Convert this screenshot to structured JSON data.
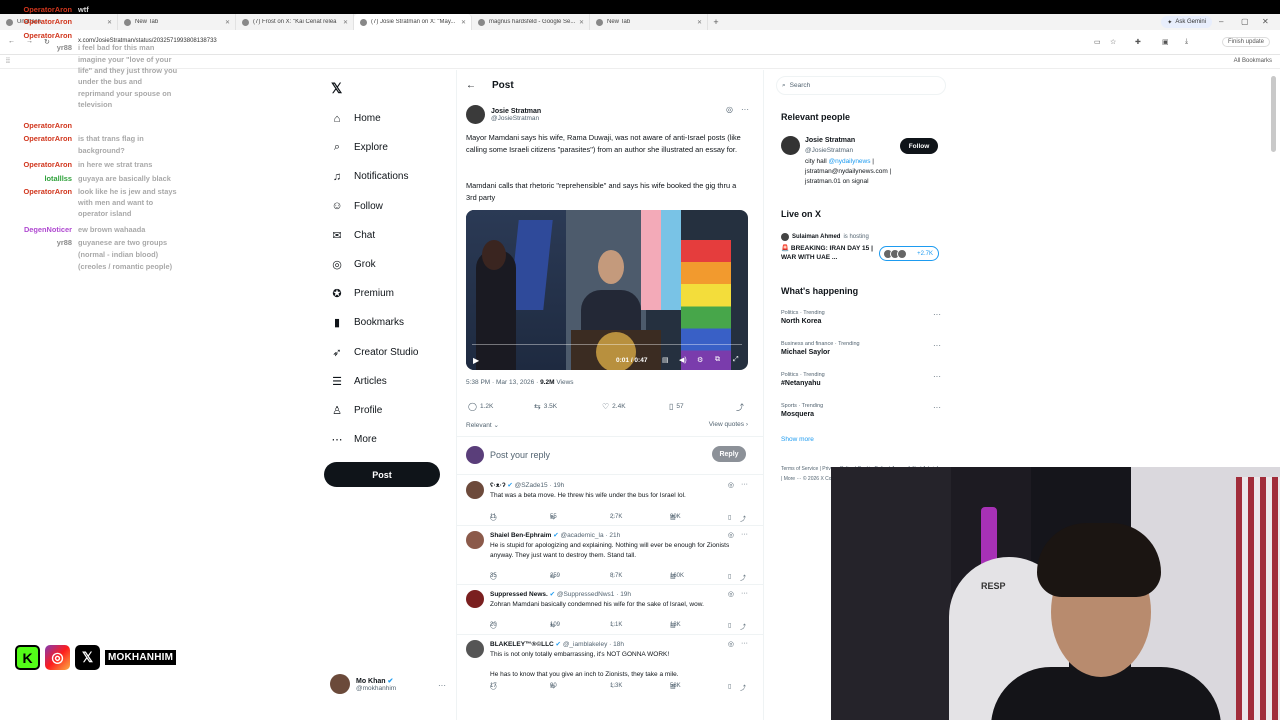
{
  "browser": {
    "tabs": [
      {
        "title": "Unattach",
        "active": false
      },
      {
        "title": "New Tab",
        "active": false
      },
      {
        "title": "(7) Frost on X: \"Kai Cenat relea",
        "active": false
      },
      {
        "title": "(7) Josie Stratman on X: \"May...",
        "active": true
      },
      {
        "title": "magnus hardsfeld - Google Se...",
        "active": false
      },
      {
        "title": "New Tab",
        "active": false
      }
    ],
    "ask_gemini": "Ask Gemini",
    "url": "x.com/JosieStratman/status/2032571993808138733",
    "finish_update": "Finish update",
    "all_bookmarks": "All Bookmarks"
  },
  "chat": [
    {
      "user": "OperatorAron",
      "color": "#d1361d",
      "msg": "wtf",
      "msg_white": true
    },
    {
      "user": "OperatorAron",
      "color": "#d1361d",
      "msg": ""
    },
    {
      "user": "OperatorAron",
      "color": "#d1361d",
      "msg": ""
    },
    {
      "user": "yr88",
      "color": "#8a8a8a",
      "msg": "i feel bad for this man"
    },
    {
      "user": "",
      "color": "#8a8a8a",
      "msg": "imagine your \"love of your"
    },
    {
      "user": "",
      "color": "#8a8a8a",
      "msg": "life\" and they just throw you"
    },
    {
      "user": "",
      "color": "#8a8a8a",
      "msg": "under the bus and"
    },
    {
      "user": "",
      "color": "#8a8a8a",
      "msg": "reprimand your spouse on"
    },
    {
      "user": "",
      "color": "#8a8a8a",
      "msg": "television"
    },
    {
      "user": "OperatorAron",
      "color": "#d1361d",
      "msg": ""
    },
    {
      "user": "OperatorAron",
      "color": "#d1361d",
      "msg": "is that trans flag in"
    },
    {
      "user": "",
      "color": "#8a8a8a",
      "msg": "background?"
    },
    {
      "user": "OperatorAron",
      "color": "#d1361d",
      "msg": "in here we strat trans"
    },
    {
      "user": "lotalllss",
      "color": "#2fa23b",
      "msg": "guyaya are basically black"
    },
    {
      "user": "OperatorAron",
      "color": "#d1361d",
      "msg": "look like he is jew and stays"
    },
    {
      "user": "",
      "color": "#8a8a8a",
      "msg": "with men and want to"
    },
    {
      "user": "",
      "color": "#8a8a8a",
      "msg": "operator island"
    },
    {
      "user": "DegenNoticer",
      "color": "#b04ad1",
      "msg": "ew brown wahaada"
    },
    {
      "user": "yr88",
      "color": "#8a8a8a",
      "msg": "guyanese are two groups"
    },
    {
      "user": "",
      "color": "#8a8a8a",
      "msg": "(normal - indian blood)"
    },
    {
      "user": "",
      "color": "#8a8a8a",
      "msg": "(creoles / romantic people)"
    }
  ],
  "nav": {
    "items": [
      {
        "label": "Home",
        "icon": "home-icon",
        "glyph": "⌂"
      },
      {
        "label": "Explore",
        "icon": "search-icon",
        "glyph": "⌕"
      },
      {
        "label": "Notifications",
        "icon": "bell-icon",
        "glyph": "♫"
      },
      {
        "label": "Follow",
        "icon": "person-plus-icon",
        "glyph": "☺"
      },
      {
        "label": "Chat",
        "icon": "message-icon",
        "glyph": "✉"
      },
      {
        "label": "Grok",
        "icon": "grok-icon",
        "glyph": "◎"
      },
      {
        "label": "Premium",
        "icon": "verified-badge-icon",
        "glyph": "✪"
      },
      {
        "label": "Bookmarks",
        "icon": "bookmark-icon",
        "glyph": "▮"
      },
      {
        "label": "Creator Studio",
        "icon": "rocket-icon",
        "glyph": "➶"
      },
      {
        "label": "Articles",
        "icon": "document-icon",
        "glyph": "☰"
      },
      {
        "label": "Profile",
        "icon": "user-icon",
        "glyph": "♙"
      },
      {
        "label": "More",
        "icon": "more-circle-icon",
        "glyph": "⋯"
      }
    ],
    "post_label": "Post",
    "account": {
      "name": "Mo Khan",
      "handle": "@mokhanhim"
    }
  },
  "post": {
    "header": "Post",
    "author_name": "Josie Stratman",
    "author_handle": "@JosieStratman",
    "text1": "Mayor Mamdani says his wife, Rama Duwaji, was not aware of anti-Israel posts (like calling some Israeli citizens \"parasites\") from an author she illustrated an essay for.",
    "text2": "Mamdani calls that rhetoric \"reprehensible\" and says his wife booked the gig thru a 3rd party",
    "video_time": "0:01 / 0:47",
    "time": "5:38 PM · Mar 13, 2026 · ",
    "views_count": "9.2M",
    "views_label": " Views",
    "replies": "1.2K",
    "reposts": "3.5K",
    "likes": "2.4K",
    "bookmarks": "57",
    "sort": "Relevant ⌄",
    "view_quotes": "View quotes ›",
    "reply_placeholder": "Post your reply",
    "reply_button": "Reply"
  },
  "replies": [
    {
      "name": "ʕ·ᴥ·ʔ",
      "handle": "@SZade15 · 19h",
      "text": "That was a beta move. He threw his wife under the bus for Israel lol.",
      "stats": [
        "11",
        "55",
        "2.7K",
        "90K"
      ]
    },
    {
      "name": "Shaiel Ben-Ephraim",
      "handle": "@academic_la · 21h",
      "text": "He is stupid for apologizing and explaining. Nothing will ever be enough for Zionists anyway. They just want to destroy them. Stand tall.",
      "stats": [
        "35",
        "259",
        "8.7K",
        "160K"
      ]
    },
    {
      "name": "Suppressed News.",
      "handle": "@SuppressedNws1 · 19h",
      "text": "Zohran Mamdani basically condemned his wife for the sake of Israel, wow.",
      "stats": [
        "20",
        "109",
        "1.1K",
        "13K"
      ]
    },
    {
      "name": "BLAKELEY™®©LLC",
      "handle": "@_iamblakeley · 18h",
      "text": "This is not only totally embarrassing, it's NOT GONNA WORK!\n\nHe has to know that you give an inch to Zionists, they take a mile.",
      "stats": [
        "17",
        "90",
        "1.3K",
        "58K"
      ]
    }
  ],
  "right": {
    "search_placeholder": "Search",
    "relevant_people": "Relevant people",
    "rp_name": "Josie Stratman",
    "rp_handle": "@JosieStratman",
    "rp_bio_1": "city hall ",
    "rp_bio_link": "@nydailynews",
    "rp_bio_2": " | jstratman@nydailynews.com | jstratman.01 on signal",
    "follow": "Follow",
    "live_title": "Live on X",
    "live_host": "Sulaiman Ahmed",
    "live_host_suffix": " is hosting",
    "live_stream": "🚨 BREAKING: IRAN DAY 15 | WAR WITH UAE ...",
    "live_count": "+2.7K",
    "happening": "What's happening",
    "trends": [
      {
        "context": "Politics · Trending",
        "name": "North Korea"
      },
      {
        "context": "Business and finance · Trending",
        "name": "Michael Saylor"
      },
      {
        "context": "Politics · Trending",
        "name": "#Netanyahu"
      },
      {
        "context": "Sports · Trending",
        "name": "Mosquera"
      }
    ],
    "show_more": "Show more",
    "footer": "Terms of Service | Privacy Policy | Cookie Policy | Accessibility | Ads info | More ··· © 2026 X Corp."
  },
  "overlay": {
    "handle": "MOKHANHIM",
    "chair_brand": "RESP"
  }
}
